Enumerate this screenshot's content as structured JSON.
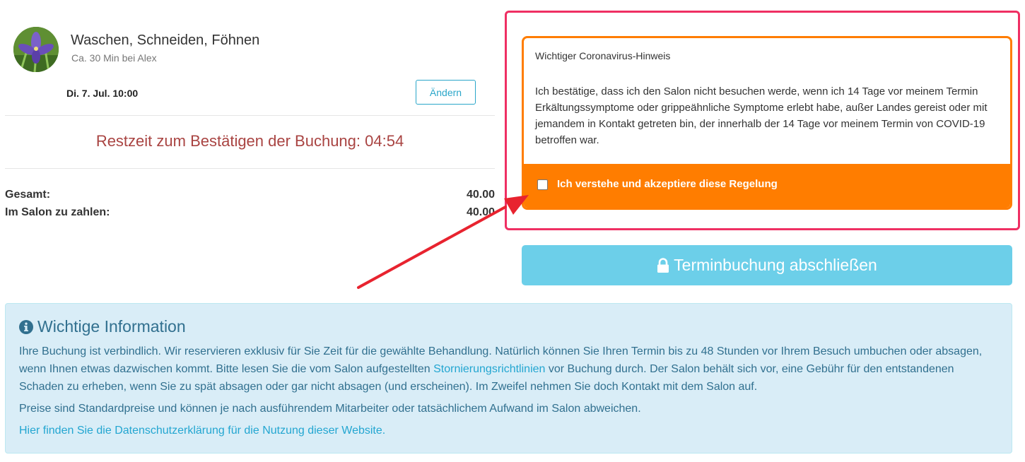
{
  "service": {
    "title": "Waschen, Schneiden, Föhnen",
    "subtitle": "Ca. 30 Min bei Alex",
    "date": "Di. 7. Jul. 10:00",
    "change_label": "Ändern"
  },
  "timer": {
    "text": "Restzeit zum Bestätigen der Buchung: 04:54"
  },
  "summary": {
    "total_label": "Gesamt:",
    "total_value": "40.00",
    "pay_label": "Im Salon zu zahlen:",
    "pay_value": "40.00"
  },
  "notice": {
    "title": "Wichtiger Coronavirus-Hinweis",
    "body": "Ich bestätige, dass ich den Salon nicht besuchen werde, wenn ich 14 Tage vor meinem Termin Erkältungssymptome oder grippeähnliche Symptome erlebt habe, außer Landes gereist oder mit jemandem in Kontakt getreten bin, der innerhalb der 14 Tage vor meinem Termin von COVID-19 betroffen war.",
    "checkbox_label": "Ich verstehe und akzeptiere diese Regelung",
    "checked": false
  },
  "submit": {
    "label": "Terminbuchung abschließen",
    "icon": "lock-icon"
  },
  "info": {
    "icon": "info-circle-icon",
    "title": "Wichtige Information",
    "para1_part1": "Ihre Buchung ist verbindlich. Wir reservieren exklusiv für Sie Zeit für die gewählte Behandlung. Natürlich können Sie Ihren Termin bis zu 48 Stunden vor Ihrem Besuch umbuchen oder absagen, wenn Ihnen etwas dazwischen kommt. Bitte lesen Sie die vom Salon aufgestellten ",
    "para1_link": "Stornierungsrichtlinien",
    "para1_part2": " vor Buchung durch. Der Salon behält sich vor, eine Gebühr für den entstandenen Schaden zu erheben, wenn Sie zu spät absagen oder gar nicht absagen (und erscheinen). Im Zweifel nehmen Sie doch Kontakt mit dem Salon auf.",
    "para2": "Preise sind Standardpreise und können je nach ausführendem Mitarbeiter oder tatsächlichem Aufwand im Salon abweichen.",
    "privacy_link": "Hier finden Sie die Datenschutzerklärung für die Nutzung dieser Website."
  },
  "colors": {
    "accent": "#2aa6c9",
    "warning": "#ff7d00",
    "highlight": "#ef2f63",
    "timer": "#a94442",
    "info_bg": "#d9edf7",
    "info_text": "#31708f",
    "submit_bg": "#6ccfe9"
  }
}
